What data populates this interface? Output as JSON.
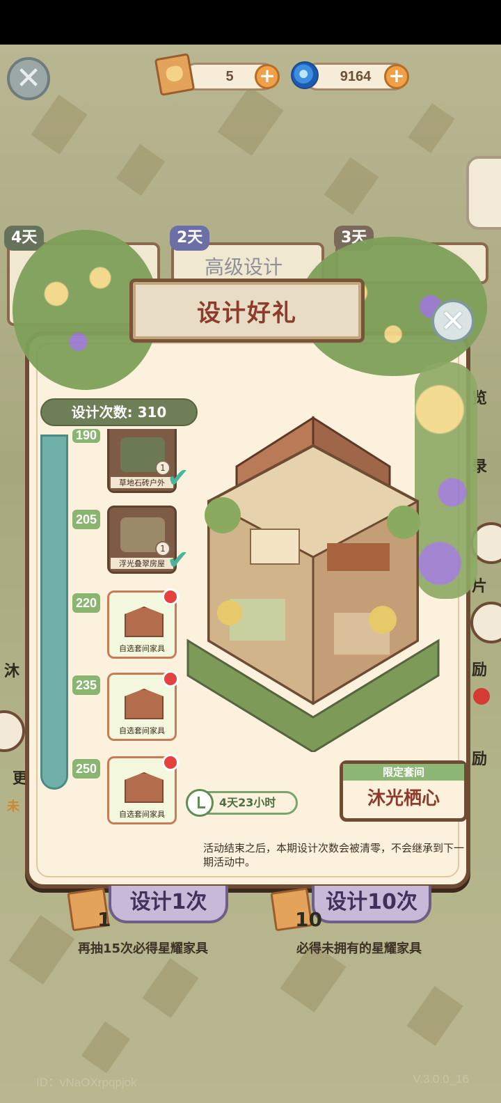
{
  "header": {
    "ticket_count": "5",
    "gem_count": "9164",
    "close_icon": "close-icon",
    "plus_icon": "plus-icon"
  },
  "background_tabs": [
    {
      "days": "4天"
    },
    {
      "days": "2天",
      "label": "高级设计"
    },
    {
      "days": "3天"
    }
  ],
  "panel": {
    "title": "设计好礼",
    "design_count_label": "设计次数: 310",
    "milestones": [
      {
        "threshold": "190",
        "name": "草地石砖户外",
        "qty": "1",
        "claimed": true
      },
      {
        "threshold": "205",
        "name": "浮光叠翠房屋",
        "qty": "1",
        "claimed": true
      },
      {
        "threshold": "220",
        "name": "自选套间家具",
        "claimed": false
      },
      {
        "threshold": "235",
        "name": "自选套间家具",
        "claimed": false
      },
      {
        "threshold": "250",
        "name": "自选套间家具",
        "claimed": false
      }
    ],
    "timer": "4天23小时",
    "limited_set_label": "限定套间",
    "limited_set_name": "沐光栖心",
    "note": "活动结束之后，本期设计次数会被清零，不会继承到下一期活动中。"
  },
  "side_fragments": {
    "right": [
      "览",
      "录",
      "片",
      "励",
      "励"
    ],
    "left": [
      "沐",
      "更",
      "未"
    ]
  },
  "actions": {
    "single": {
      "label": "设计1次",
      "cost": "1",
      "hint": "再抽15次必得星耀家具"
    },
    "ten": {
      "label": "设计10次",
      "cost": "10",
      "hint": "必得未拥有的星耀家具"
    }
  },
  "footer": {
    "id": "ID：vNaOXrpqpjok",
    "version": "V.3.0.0_16"
  },
  "colors": {
    "panel_bg": "#fbf1dc",
    "frame": "#6e4c33",
    "title_text": "#8c3b2c",
    "progress": "#6fb1a8",
    "milestone_green": "#8ab571",
    "button_purple": "#c9b9d8"
  }
}
